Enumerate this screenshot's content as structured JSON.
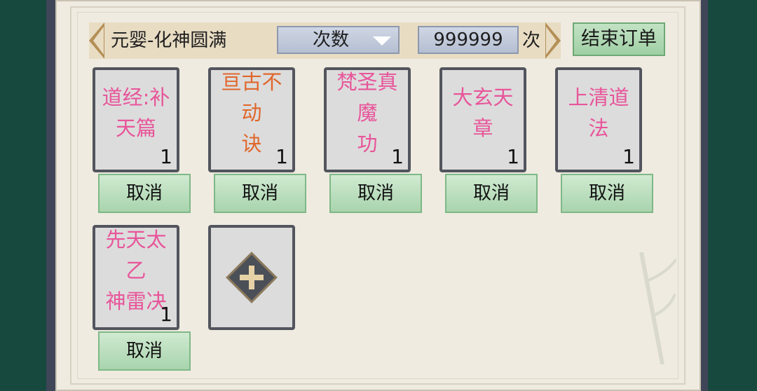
{
  "header": {
    "order_title": "元婴-化神圆满",
    "dropdown_label": "次数",
    "count_value": "999999",
    "count_unit": "次",
    "end_order_label": "结束订单"
  },
  "slots": [
    {
      "name_line1": "道经:补",
      "name_line2": "天篇",
      "count": "1",
      "cancel_label": "取消"
    },
    {
      "name_line1": "亘古不动",
      "name_line2": "诀",
      "count": "1",
      "cancel_label": "取消"
    },
    {
      "name_line1": "梵圣真魔",
      "name_line2": "功",
      "count": "1",
      "cancel_label": "取消"
    },
    {
      "name_line1": "大玄天章",
      "name_line2": "",
      "count": "1",
      "cancel_label": "取消"
    },
    {
      "name_line1": "上清道法",
      "name_line2": "",
      "count": "1",
      "cancel_label": "取消"
    },
    {
      "name_line1": "先天太乙",
      "name_line2": "神雷决",
      "count": "1",
      "cancel_label": "取消"
    }
  ],
  "colors": {
    "pink_text": "#e8559a",
    "orange_text": "#e0672c",
    "cancel_green": "#a8d4ad",
    "background": "#17493f"
  },
  "icons": {
    "add_slot": "plus-diamond-icon",
    "dropdown": "triangle-down-icon"
  }
}
